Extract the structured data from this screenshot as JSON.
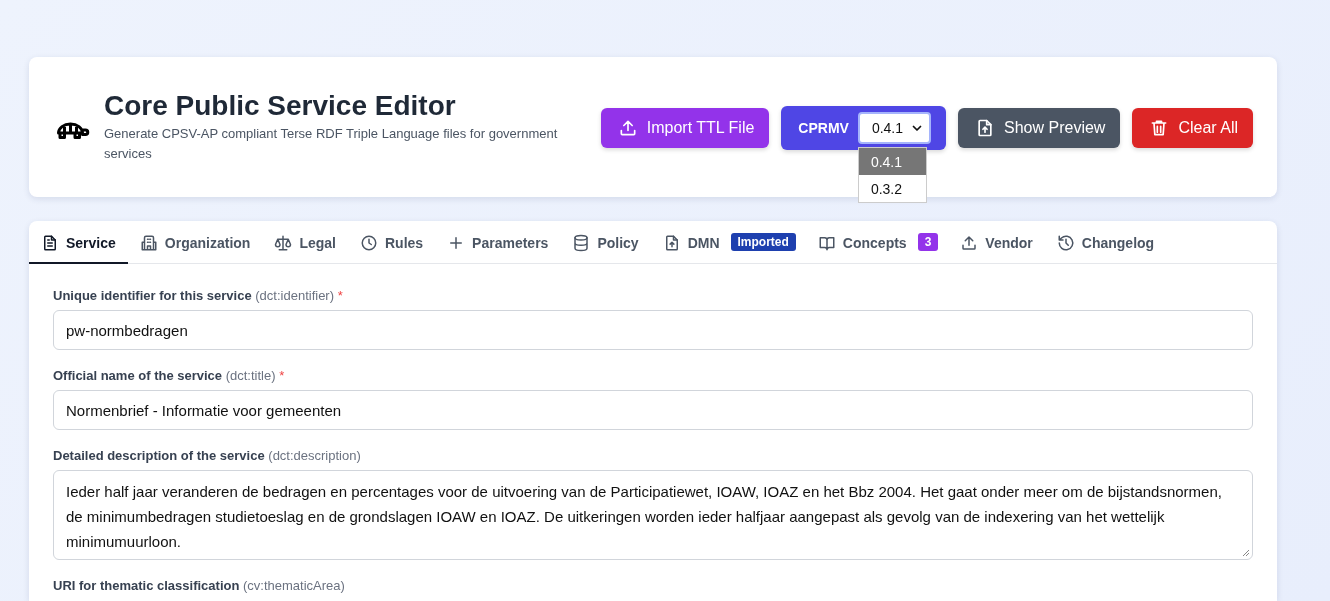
{
  "header": {
    "title": "Core Public Service Editor",
    "subtitle": "Generate CPSV-AP compliant Terse RDF Triple Language files for government services"
  },
  "actions": [
    {
      "kind": "import",
      "label": "Import TTL File"
    },
    {
      "kind": "version",
      "label": "CPRMV",
      "value": "0.4.1",
      "expanded": true,
      "options": [
        {
          "label": "0.4.1",
          "selected": true
        },
        {
          "label": "0.3.2",
          "selected": false
        }
      ]
    },
    {
      "kind": "preview",
      "label": "Show Preview"
    },
    {
      "kind": "clear",
      "label": "Clear All"
    }
  ],
  "tabs": [
    {
      "label": "Service",
      "selected": true
    },
    {
      "label": "Organization",
      "selected": false
    },
    {
      "label": "Legal",
      "selected": false
    },
    {
      "label": "Rules",
      "selected": false
    },
    {
      "label": "Parameters",
      "selected": false
    },
    {
      "label": "Policy",
      "selected": false
    },
    {
      "label": "DMN",
      "selected": false,
      "badge": {
        "text": "Imported",
        "color": "#1e40af"
      }
    },
    {
      "label": "Concepts",
      "selected": false,
      "badge": {
        "text": "3",
        "color": "#9333ea"
      }
    },
    {
      "label": "Vendor",
      "selected": false
    },
    {
      "label": "Changelog",
      "selected": false
    }
  ],
  "fields": [
    {
      "kind": "input",
      "label": "Unique identifier for this service",
      "hint": "(dct:identifier)",
      "required_mark": "*",
      "value": "pw-normbedragen"
    },
    {
      "kind": "input",
      "label": "Official name of the service",
      "hint": "(dct:title)",
      "required_mark": "*",
      "value": "Normenbrief - Informatie voor gemeenten"
    },
    {
      "kind": "textarea",
      "label": "Detailed description of the service",
      "hint": "(dct:description)",
      "value": "Ieder half jaar veranderen de bedragen en percentages voor de uitvoering van de Participatiewet, IOAW, IOAZ en het Bbz 2004. Het gaat onder meer om de bijstandsnormen, de minimumbedragen studietoeslag en de grondslagen IOAW en IOAZ. De uitkeringen worden ieder halfjaar aangepast als gevolg van de indexering van het wettelijk minimumuurloon."
    },
    {
      "kind": "label_only",
      "label": "URI for thematic classification",
      "hint": "(cv:thematicArea)"
    }
  ]
}
